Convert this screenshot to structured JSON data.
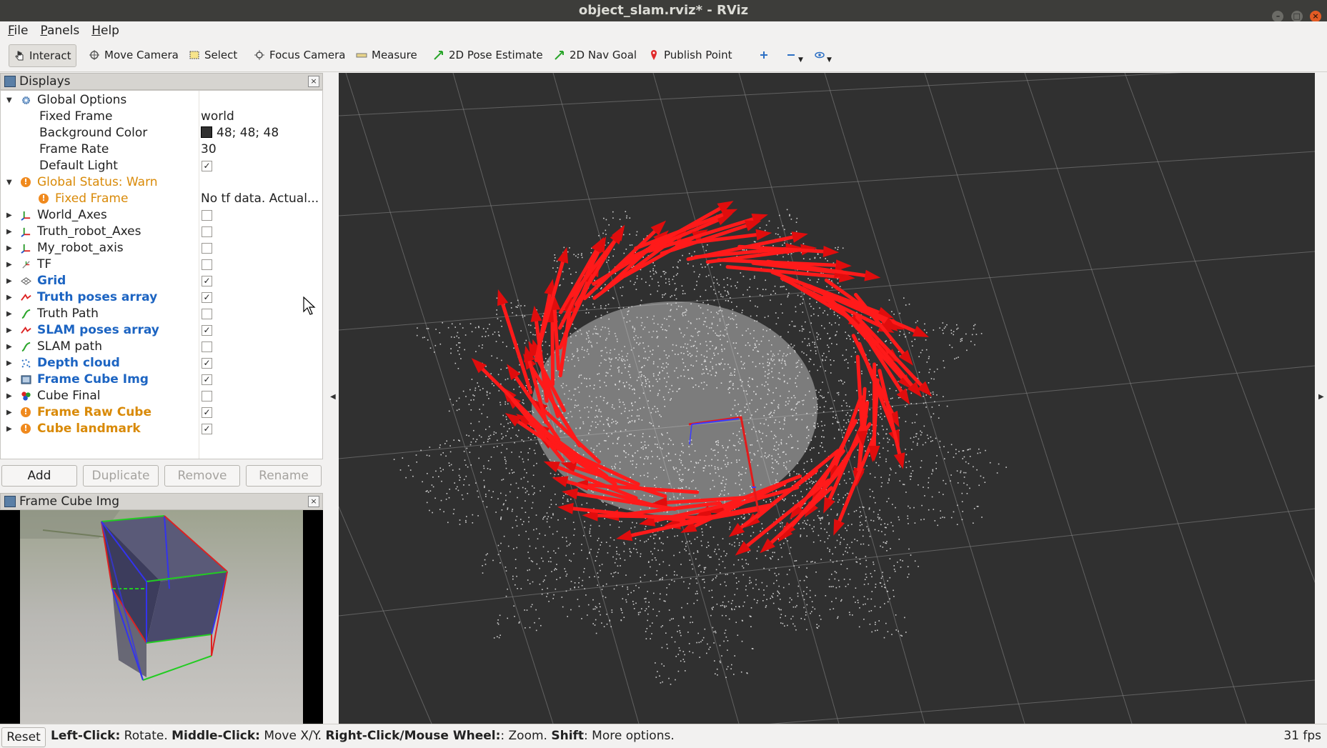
{
  "window": {
    "title": "object_slam.rviz* - RViz"
  },
  "menu": {
    "file": "File",
    "panels": "Panels",
    "help": "Help"
  },
  "toolbar": {
    "interact": "Interact",
    "move_camera": "Move Camera",
    "select": "Select",
    "focus_camera": "Focus Camera",
    "measure": "Measure",
    "pose_estimate": "2D Pose Estimate",
    "nav_goal": "2D Nav Goal",
    "publish_point": "Publish Point"
  },
  "displays": {
    "title": "Displays",
    "global_options": {
      "label": "Global Options",
      "fixed_frame_label": "Fixed Frame",
      "fixed_frame_value": "world",
      "bg_color_label": "Background Color",
      "bg_color_value": "48; 48; 48",
      "frame_rate_label": "Frame Rate",
      "frame_rate_value": "30",
      "default_light_label": "Default Light",
      "default_light_checked": true
    },
    "global_status": {
      "label": "Global Status: Warn",
      "fixed_frame_label": "Fixed Frame",
      "fixed_frame_value": "No tf data.  Actual..."
    },
    "items": [
      {
        "label": "World_Axes",
        "checked": false
      },
      {
        "label": "Truth_robot_Axes",
        "checked": false
      },
      {
        "label": "My_robot_axis",
        "checked": false
      },
      {
        "label": "TF",
        "checked": false
      },
      {
        "label": "Grid",
        "checked": true
      },
      {
        "label": "Truth poses array",
        "checked": true
      },
      {
        "label": "Truth Path",
        "checked": false
      },
      {
        "label": "SLAM poses array",
        "checked": true
      },
      {
        "label": "SLAM path",
        "checked": false
      },
      {
        "label": "Depth cloud",
        "checked": true
      },
      {
        "label": "Frame Cube Img",
        "checked": true
      },
      {
        "label": "Cube Final",
        "checked": false
      },
      {
        "label": "Frame Raw Cube",
        "checked": true
      },
      {
        "label": "Cube landmark",
        "checked": true
      }
    ],
    "buttons": {
      "add": "Add",
      "duplicate": "Duplicate",
      "remove": "Remove",
      "rename": "Rename"
    }
  },
  "image_panel": {
    "title": "Frame Cube Img"
  },
  "status": {
    "reset": "Reset",
    "lc_key": "Left-Click:",
    "lc_val": " Rotate. ",
    "mc_key": "Middle-Click:",
    "mc_val": " Move X/Y. ",
    "rc_key": "Right-Click/Mouse Wheel:",
    "rc_val": ": Zoom. ",
    "shift_key": "Shift",
    "shift_val": ": More options.",
    "fps": "31 fps"
  },
  "colors": {
    "background": "#303030",
    "arrows": "#ff1a1a",
    "cloud": "#d8d8d8",
    "accent_blue": "#1c64c2",
    "warn": "#d98a08"
  }
}
